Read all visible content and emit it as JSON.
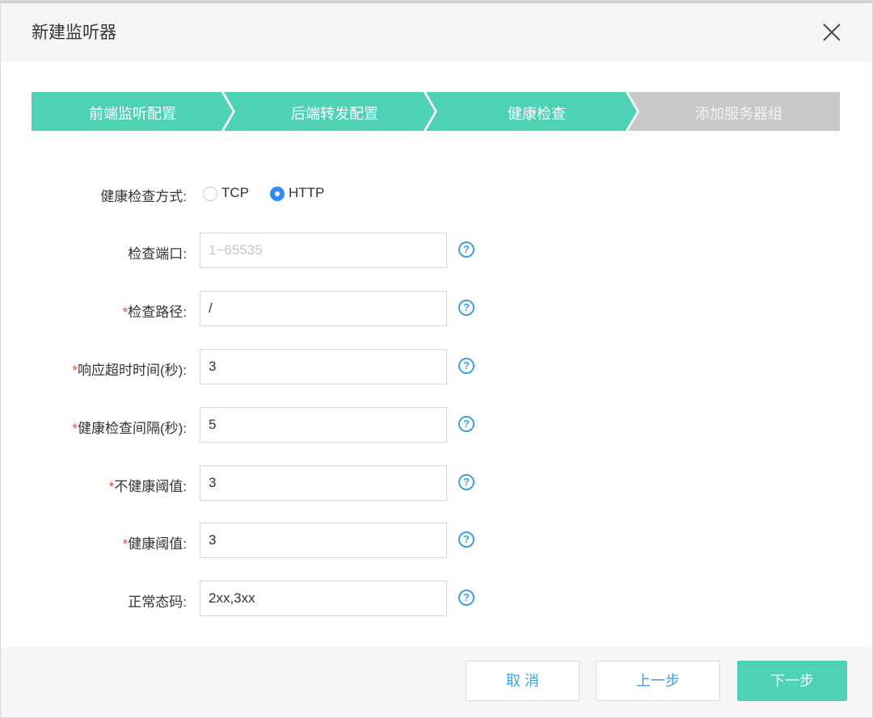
{
  "dialog": {
    "title": "新建监听器"
  },
  "steps": [
    {
      "label": "前端监听配置",
      "state": "done"
    },
    {
      "label": "后端转发配置",
      "state": "done"
    },
    {
      "label": "健康检查",
      "state": "active"
    },
    {
      "label": "添加服务器组",
      "state": "pending"
    }
  ],
  "colors": {
    "step_active": "#4fd1b5",
    "step_pending": "#c8c8c8",
    "required": "#e84a4a",
    "link": "#3b9fe8"
  },
  "form": {
    "method": {
      "label": "健康检查方式:",
      "options": [
        "TCP",
        "HTTP"
      ],
      "selected": "HTTP"
    },
    "port": {
      "label": "检查端口:",
      "value": "",
      "placeholder": "1~65535"
    },
    "path": {
      "required": "*",
      "label": "检查路径:",
      "value": "/"
    },
    "timeout": {
      "required": "*",
      "label": "响应超时时间(秒):",
      "value": "3"
    },
    "interval": {
      "required": "*",
      "label": "健康检查间隔(秒):",
      "value": "5"
    },
    "unhealthy": {
      "required": "*",
      "label": "不健康阈值:",
      "value": "3"
    },
    "healthy": {
      "required": "*",
      "label": "健康阈值:",
      "value": "3"
    },
    "status_code": {
      "label": "正常态码:",
      "value": "2xx,3xx"
    },
    "help_glyph": "?"
  },
  "footer": {
    "cancel": "取 消",
    "prev": "上一步",
    "next": "下一步"
  }
}
